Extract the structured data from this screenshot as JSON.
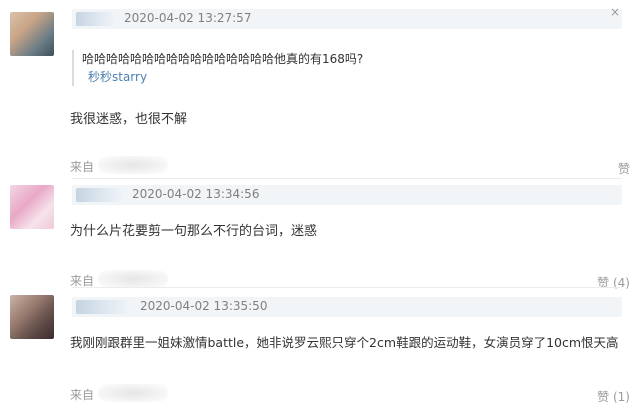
{
  "comments": [
    {
      "timestamp": "2020-04-02 13:27:57",
      "quote": {
        "text": "哈哈哈哈哈哈哈哈哈哈哈哈哈哈哈哈他真的有168吗?",
        "author": "秒秒starry"
      },
      "body": "我很迷惑，也很不解",
      "from_label": "来自",
      "like_label": "赞"
    },
    {
      "timestamp": "2020-04-02 13:34:56",
      "body": "为什么片花要剪一句那么不行的台词，迷惑",
      "from_label": "来自",
      "like_label": "赞 (4)"
    },
    {
      "timestamp": "2020-04-02 13:35:50",
      "body": "我刚刚跟群里一姐妹激情battle，她非说罗云熙只穿个2cm鞋跟的运动鞋，女演员穿了10cm恨天高",
      "from_label": "来自",
      "like_label": "赞 (1)"
    }
  ],
  "close_glyph": "×",
  "colors": {
    "header_bar": "#f2f5f7",
    "link": "#4d80b0",
    "text": "#333333",
    "meta": "#808080"
  }
}
